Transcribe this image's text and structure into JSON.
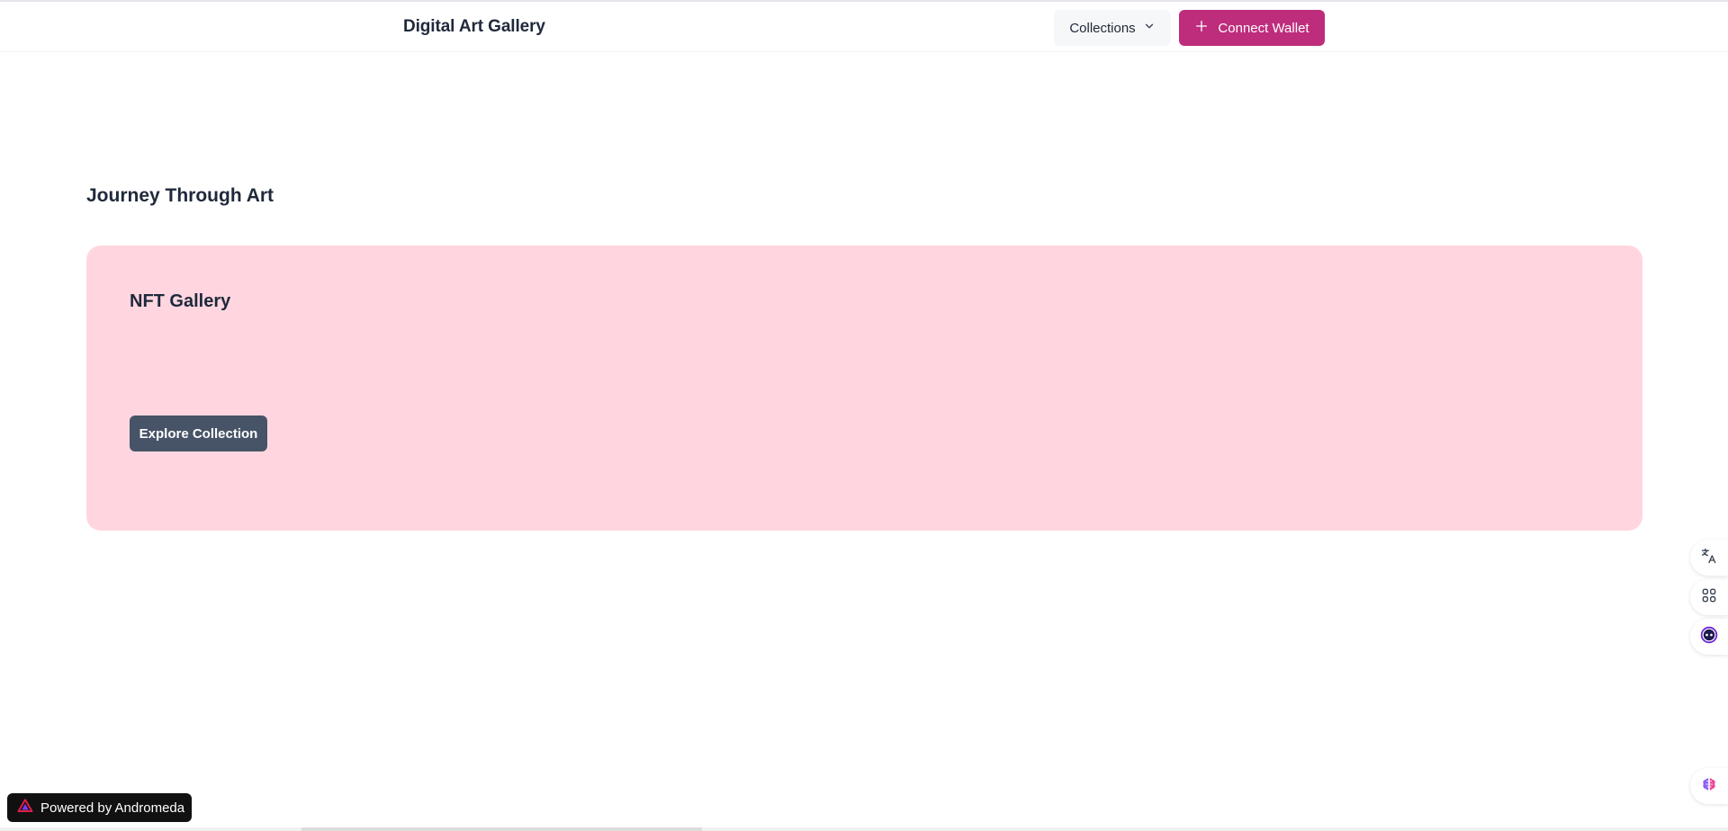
{
  "header": {
    "brand": "Digital Art Gallery",
    "collections_label": "Collections",
    "connect_label": "Connect Wallet"
  },
  "main": {
    "section_title": "Journey Through Art",
    "card": {
      "title": "NFT Gallery",
      "button_label": "Explore Collection",
      "background": "#ffd6e0"
    }
  },
  "side_tools": {
    "icons": [
      "translate-icon",
      "apps-icon",
      "assistant-icon",
      "brain-icon"
    ]
  },
  "footer_badge": {
    "label": "Powered by Andromeda",
    "icon": "andromeda-logo-icon"
  },
  "colors": {
    "accent": "#be2d7c",
    "dark_button": "#475467",
    "text": "#1e293b"
  }
}
